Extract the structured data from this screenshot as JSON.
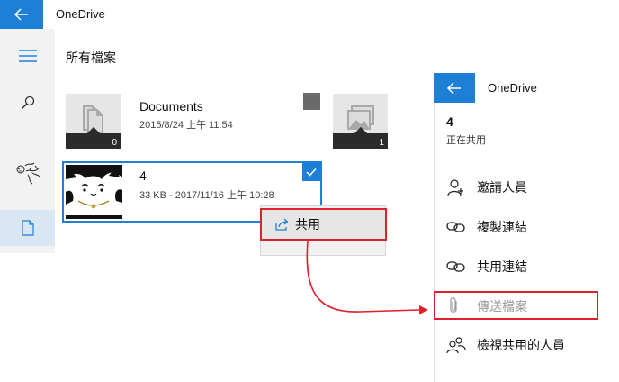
{
  "window": {
    "app_title": "OneDrive",
    "page_title": "所有檔案"
  },
  "files": [
    {
      "name": "Documents",
      "meta": "2015/8/24 上午 11:54",
      "count": "0",
      "icon": "document-folder-icon"
    },
    {
      "name": "4",
      "meta": "33 KB - 2017/11/16 上午 10:28",
      "selected": true,
      "icon": "photo-thumbnail"
    },
    {
      "count": "1",
      "icon": "photo-folder-icon"
    }
  ],
  "context_menu": {
    "share_label": "共用"
  },
  "share_panel": {
    "app_title": "OneDrive",
    "count": "4",
    "subtitle": "正在共用",
    "items": [
      {
        "label": "邀請人員",
        "icon": "invite-person-icon",
        "enabled": true
      },
      {
        "label": "複製連結",
        "icon": "link-icon",
        "enabled": true
      },
      {
        "label": "共用連結",
        "icon": "link-icon",
        "enabled": true
      },
      {
        "label": "傳送檔案",
        "icon": "paperclip-icon",
        "enabled": false
      },
      {
        "label": "檢視共用的人員",
        "icon": "people-icon",
        "enabled": true
      }
    ]
  },
  "colors": {
    "accent": "#1e7fd6",
    "highlight": "#e0202a",
    "rail": "#f2f2f2"
  }
}
